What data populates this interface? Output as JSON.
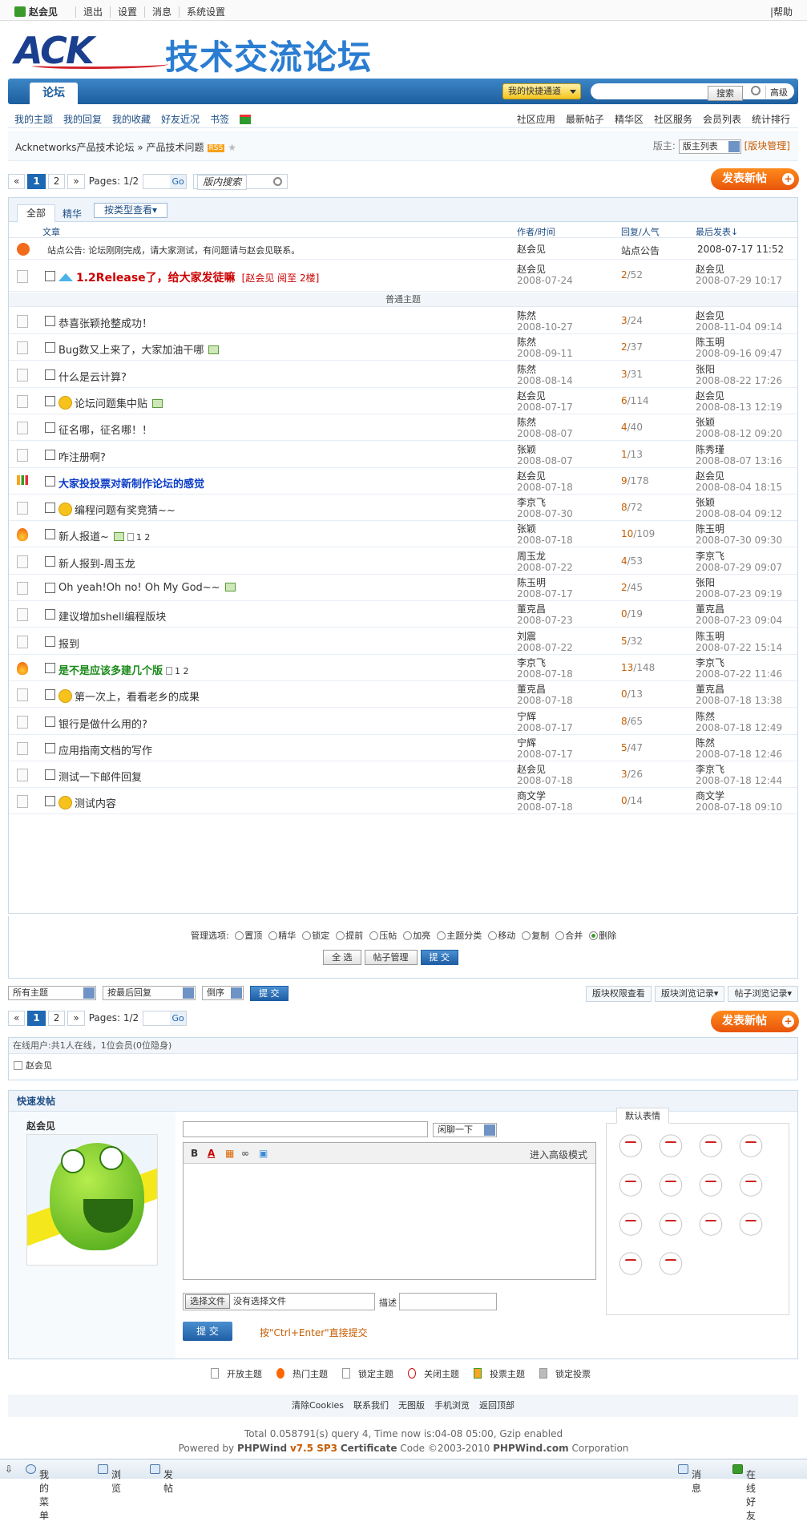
{
  "topbar": {
    "user": "赵会见",
    "links": [
      "退出",
      "设置",
      "消息",
      "系统设置"
    ],
    "help": "|帮助"
  },
  "logo": {
    "ack": "ACK",
    "title": "技术交流论坛"
  },
  "nav": {
    "tab": "论坛",
    "quick": "我的快捷通道",
    "search_btn": "搜索",
    "advanced": "高级"
  },
  "subnav": {
    "left": [
      "我的主题",
      "我的回复",
      "我的收藏",
      "好友近况",
      "书签"
    ],
    "right": [
      "社区应用",
      "最新帖子",
      "精华区",
      "社区服务",
      "会员列表",
      "统计排行"
    ]
  },
  "crumb": {
    "forum": "Acknetworks产品技术论坛",
    "sep": "»",
    "board": "产品技术问题",
    "rss": "RSS",
    "moderator_label": "版主:",
    "moderator_select": "版主列表",
    "manage": "[版块管理]"
  },
  "pager": {
    "first": "«",
    "p1": "1",
    "p2": "2",
    "last": "»",
    "pages": "Pages: 1/2",
    "go": "Go",
    "search_placeholder": "版内搜索"
  },
  "post_new": "发表新帖",
  "tabs": {
    "all": "全部",
    "digest": "精华",
    "by_type": "按类型查看▾"
  },
  "columns": {
    "article": "文章",
    "author": "作者/时间",
    "reply": "回复/人气",
    "last": "最后发表↓"
  },
  "announce": {
    "title": "站点公告: 论坛刚刚完成，请大家测试，有问题请与赵会见联系。",
    "author": "赵会见",
    "reply": "站点公告",
    "last": "2008-07-17 11:52"
  },
  "sticky": {
    "title": "1.2Release了，给大家发徒嘛",
    "note": "[赵会见 阅至 2楼]",
    "author": "赵会见",
    "date": "2008-07-24",
    "r": "2",
    "v": "/52",
    "last_user": "赵会见",
    "last_time": "2008-07-29 10:17"
  },
  "section": "普通主题",
  "threads": [
    {
      "title": "恭喜张颖抢整成功！",
      "author": "陈然",
      "date": "2008-10-27",
      "r": "3",
      "v": "/24",
      "lu": "赵会见",
      "lt": "2008-11-04 09:14"
    },
    {
      "title": "Bug数又上来了，大家加油干哪",
      "author": "陈然",
      "date": "2008-09-11",
      "r": "2",
      "v": "/37",
      "lu": "陈玉明",
      "lt": "2008-09-16 09:47"
    },
    {
      "title": "什么是云计算?",
      "author": "陈然",
      "date": "2008-08-14",
      "r": "3",
      "v": "/31",
      "lu": "张阳",
      "lt": "2008-08-22 17:26"
    },
    {
      "title": "论坛问题集中贴",
      "author": "赵会见",
      "date": "2008-07-17",
      "r": "6",
      "v": "/114",
      "lu": "赵会见",
      "lt": "2008-08-13 12:19"
    },
    {
      "title": "征名哪，征名哪！！",
      "author": "陈然",
      "date": "2008-08-07",
      "r": "4",
      "v": "/40",
      "lu": "张颖",
      "lt": "2008-08-12 09:20"
    },
    {
      "title": "咋注册啊?",
      "author": "张颖",
      "date": "2008-08-07",
      "r": "1",
      "v": "/13",
      "lu": "陈秀瑾",
      "lt": "2008-08-07 13:16"
    },
    {
      "title": "大家投投票对新制作论坛的感觉",
      "author": "赵会见",
      "date": "2008-07-18",
      "r": "9",
      "v": "/178",
      "lu": "赵会见",
      "lt": "2008-08-04 18:15"
    },
    {
      "title": "编程问题有奖竞猜~~",
      "author": "李京飞",
      "date": "2008-07-30",
      "r": "8",
      "v": "/72",
      "lu": "张颖",
      "lt": "2008-08-04 09:12"
    },
    {
      "title": "新人报道~",
      "author": "张颖",
      "date": "2008-07-18",
      "r": "10",
      "v": "/109",
      "lu": "陈玉明",
      "lt": "2008-07-30 09:30",
      "pages": "1 2"
    },
    {
      "title": "新人报到-周玉龙",
      "author": "周玉龙",
      "date": "2008-07-22",
      "r": "4",
      "v": "/53",
      "lu": "李京飞",
      "lt": "2008-07-29 09:07"
    },
    {
      "title": "Oh yeah!Oh no! Oh My God~~",
      "author": "陈玉明",
      "date": "2008-07-17",
      "r": "2",
      "v": "/45",
      "lu": "张阳",
      "lt": "2008-07-23 09:19"
    },
    {
      "title": "建议增加shell编程版块",
      "author": "董克昌",
      "date": "2008-07-23",
      "r": "0",
      "v": "/19",
      "lu": "董克昌",
      "lt": "2008-07-23 09:04"
    },
    {
      "title": "报到",
      "author": "刘震",
      "date": "2008-07-22",
      "r": "5",
      "v": "/32",
      "lu": "陈玉明",
      "lt": "2008-07-22 15:14"
    },
    {
      "title": "是不是应该多建几个版",
      "author": "李京飞",
      "date": "2008-07-18",
      "r": "13",
      "v": "/148",
      "lu": "李京飞",
      "lt": "2008-07-22 11:46",
      "pages": "1 2"
    },
    {
      "title": "第一次上，看看老乡的成果",
      "author": "董克昌",
      "date": "2008-07-18",
      "r": "0",
      "v": "/13",
      "lu": "董克昌",
      "lt": "2008-07-18 13:38"
    },
    {
      "title": "银行是做什么用的?",
      "author": "宁辉",
      "date": "2008-07-17",
      "r": "8",
      "v": "/65",
      "lu": "陈然",
      "lt": "2008-07-18 12:49"
    },
    {
      "title": "应用指南文档的写作",
      "author": "宁辉",
      "date": "2008-07-17",
      "r": "5",
      "v": "/47",
      "lu": "陈然",
      "lt": "2008-07-18 12:46"
    },
    {
      "title": "测试一下邮件回复",
      "author": "赵会见",
      "date": "2008-07-18",
      "r": "3",
      "v": "/26",
      "lu": "李京飞",
      "lt": "2008-07-18 12:44"
    },
    {
      "title": "测试内容",
      "author": "商文学",
      "date": "2008-07-18",
      "r": "0",
      "v": "/14",
      "lu": "商文学",
      "lt": "2008-07-18 09:10"
    }
  ],
  "manage": {
    "label": "管理选项:",
    "options": [
      "置顶",
      "精华",
      "锁定",
      "提前",
      "压帖",
      "加亮",
      "主题分类",
      "移动",
      "复制",
      "合并",
      "删除"
    ],
    "select_all": "全 选",
    "thread_manage": "帖子管理",
    "submit": "提 交"
  },
  "filters": {
    "topic": "所有主题",
    "sort": "按最后回复",
    "order": "倒序",
    "submit": "提 交",
    "right": [
      "版块权限查看",
      "版块浏览记录▾",
      "帖子浏览记录▾"
    ]
  },
  "online": {
    "header": "在线用户:共1人在线，1位会员(0位隐身)",
    "user": "赵会见"
  },
  "quick": {
    "header": "快速发帖",
    "name": "赵会见",
    "mode": "闲聊一下",
    "advanced": "进入高级模式",
    "file_btn": "选择文件",
    "file_none": "没有选择文件",
    "desc": "描述",
    "submit": "提 交",
    "hint": "按\"Ctrl+Enter\"直接提交",
    "smile_tab": "默认表情"
  },
  "legend": [
    "开放主题",
    "热门主题",
    "锁定主题",
    "关闭主题",
    "投票主题",
    "锁定投票"
  ],
  "footer_links": [
    "清除Cookies",
    "联系我们",
    "无图版",
    "手机浏览",
    "返回顶部"
  ],
  "copyright": {
    "line1": "Total 0.058791(s) query 4, Time now is:04-08 05:00, Gzip enabled",
    "powered": "Powered by",
    "pw": "PHPWind",
    "ver": "v7.5 SP3",
    "cert": "Certificate",
    "code": "Code ©2003-2010",
    "site": "PHPWind.com",
    "corp": "Corporation"
  },
  "bottombar": {
    "menu": "我的菜单",
    "browse": "浏览",
    "post": "发帖",
    "msg": "消息",
    "friends": "在线好友"
  }
}
